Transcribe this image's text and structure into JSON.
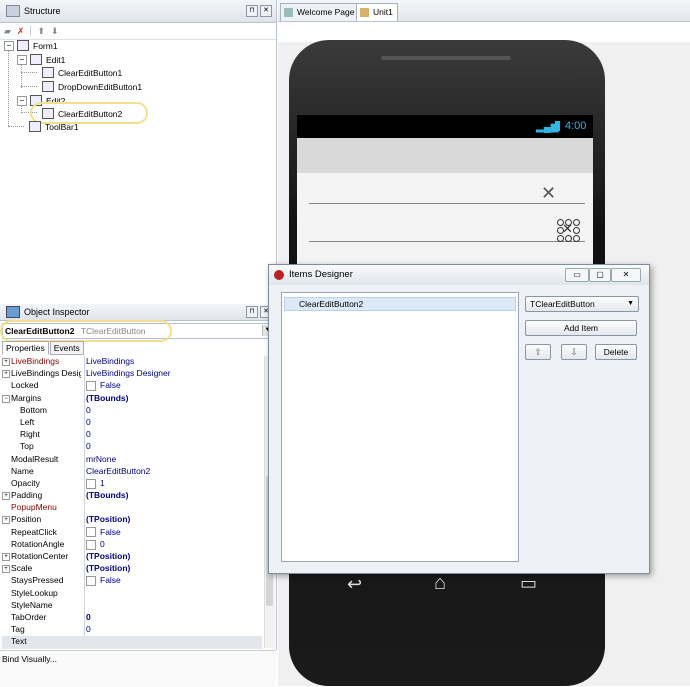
{
  "structure": {
    "title": "Structure",
    "tree": [
      {
        "label": "Form1"
      },
      {
        "label": "Edit1"
      },
      {
        "label": "ClearEditButton1"
      },
      {
        "label": "DropDownEditButton1"
      },
      {
        "label": "Edit2"
      },
      {
        "label": "ClearEditButton2"
      },
      {
        "label": "ToolBar1"
      }
    ],
    "expanders": [
      "−",
      "−",
      "−"
    ]
  },
  "inspector": {
    "title": "Object Inspector",
    "selected_name": "ClearEditButton2",
    "selected_type": "TClearEditButton",
    "tabs": [
      "Properties",
      "Events"
    ],
    "properties": [
      {
        "name": "LiveBindings",
        "value": "LiveBindings",
        "exp": "+"
      },
      {
        "name": "LiveBindings Designer",
        "value": "LiveBindings Designer",
        "exp": "+"
      },
      {
        "name": "Locked",
        "value": "False",
        "check": true
      },
      {
        "name": "Margins",
        "value": "(TBounds)",
        "exp": "−"
      },
      {
        "name": "Bottom",
        "value": "0",
        "indent": true
      },
      {
        "name": "Left",
        "value": "0",
        "indent": true
      },
      {
        "name": "Right",
        "value": "0",
        "indent": true
      },
      {
        "name": "Top",
        "value": "0",
        "indent": true
      },
      {
        "name": "ModalResult",
        "value": "mrNone"
      },
      {
        "name": "Name",
        "value": "ClearEditButton2"
      },
      {
        "name": "Opacity",
        "value": "1",
        "check": true
      },
      {
        "name": "Padding",
        "value": "(TBounds)",
        "exp": "+"
      },
      {
        "name": "PopupMenu",
        "value": ""
      },
      {
        "name": "Position",
        "value": "(TPosition)",
        "exp": "+"
      },
      {
        "name": "RepeatClick",
        "value": "False",
        "check": true
      },
      {
        "name": "RotationAngle",
        "value": "0",
        "check": true
      },
      {
        "name": "RotationCenter",
        "value": "(TPosition)",
        "exp": "+"
      },
      {
        "name": "Scale",
        "value": "(TPosition)",
        "exp": "+"
      },
      {
        "name": "StaysPressed",
        "value": "False",
        "check": true
      },
      {
        "name": "StyleLookup",
        "value": ""
      },
      {
        "name": "StyleName",
        "value": ""
      },
      {
        "name": "TabOrder",
        "value": "0"
      },
      {
        "name": "Tag",
        "value": "0"
      },
      {
        "name": "Text",
        "value": ""
      }
    ],
    "bind_visually": "Bind Visually..."
  },
  "editor": {
    "tabs": [
      "Welcome Page",
      "Unit1"
    ]
  },
  "phone": {
    "time": "4:00",
    "clear_glyph": "✕",
    "nav_back": "↩",
    "nav_home": "⌂",
    "nav_recent": "▭"
  },
  "dialog": {
    "title": "Items Designer",
    "list_items": [
      "ClearEditButton2"
    ],
    "combo_value": "TClearEditButton",
    "add_item": "Add Item",
    "delete": "Delete",
    "up": "⇧",
    "down": "⇩",
    "window_buttons": [
      "▭",
      "▢",
      "✕"
    ]
  },
  "colors": {
    "accent": "#33b5e5",
    "highlight": "#f3e08a",
    "dark_red": "#8b0000",
    "navy": "#000080"
  }
}
